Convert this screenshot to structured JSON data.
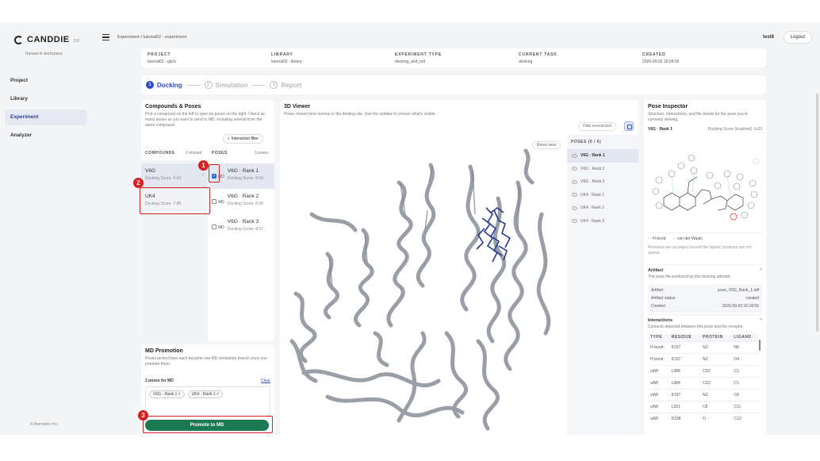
{
  "app": {
    "name": "CANDDIE",
    "version": "2.0",
    "subtitle": "Research workspace",
    "copyright": "© Atomatrix Inc."
  },
  "nav": [
    {
      "label": "Project",
      "active": false
    },
    {
      "label": "Library",
      "active": false
    },
    {
      "label": "Experiment",
      "active": true
    },
    {
      "label": "Analyzer",
      "active": false
    }
  ],
  "topbar": {
    "breadcrumb": "Experiment / tutorial02 - experiment",
    "user": "test8",
    "logout": "Logout"
  },
  "info": [
    {
      "label": "PROJECT",
      "value": "tutorial02 - glp1r"
    },
    {
      "label": "LIBRARY",
      "value": "tutorial02 - library"
    },
    {
      "label": "EXPERIMENT TYPE",
      "value": "docking_and_md"
    },
    {
      "label": "CURRENT TASK",
      "value": "docking"
    },
    {
      "label": "CREATED",
      "value": "2026-09-02 16:04:50"
    }
  ],
  "steps": [
    {
      "num": "1",
      "label": "Docking",
      "active": true
    },
    {
      "num": "2",
      "label": "Simulation",
      "active": false
    },
    {
      "num": "3",
      "label": "Report",
      "active": false
    }
  ],
  "compounds_panel": {
    "title": "Compounds & Poses",
    "desc": "Pick a compound on the left to open its poses on the right. Check as many poses as you want to send to MD, including several from the same compound.",
    "filter": "Interaction filter",
    "compounds_head": "COMPOUNDS",
    "compounds_sub": "2 docked",
    "poses_head": "POSES",
    "poses_sub": "3 poses",
    "compounds": [
      {
        "name": "V6G",
        "score": "Docking Score -9.63"
      },
      {
        "name": "UK4",
        "score": "Docking Score -7.85"
      }
    ],
    "poses": [
      {
        "tag": "MD",
        "name": "V6G · Rank 1",
        "score": "Docking Score -9.63",
        "checked": true
      },
      {
        "tag": "MD",
        "name": "V6G · Rank 2",
        "score": "Docking Score -9.00",
        "checked": false
      },
      {
        "tag": "MD",
        "name": "V6G · Rank 3",
        "score": "Docking Score -8.57",
        "checked": false
      }
    ]
  },
  "md_panel": {
    "title": "MD Promotion",
    "desc": "Poses picked here each become one MD simulation branch once you promote them.",
    "count": "2 poses for MD",
    "clear": "Clear",
    "chips": [
      "V6G · Rank 1 ×",
      "UK4 · Rank 1 ×"
    ],
    "button": "Promote to MD"
  },
  "viewer": {
    "title": "3D Viewer",
    "desc": "Poses shown here overlay in the binding site. Use the sidebar to choose what's visible.",
    "hide_btn": "Hide unselected",
    "reset": "Reset view",
    "poses_head": "POSES (0 / 6)",
    "poses": [
      "V6G · Rank 1",
      "V6G · Rank 2",
      "V6G · Rank 3",
      "UK4 · Rank 1",
      "UK4 · Rank 2",
      "UK4 · Rank 3"
    ]
  },
  "inspector": {
    "title": "Pose Inspector",
    "desc": "Structure, interactions, and file details for the pose you're currently viewing.",
    "pose": "V6G · Rank 1",
    "score": "Docking Score (kcal/mol) -9.63",
    "legend_hbond": "H-bond",
    "legend_vdw": "van der Waals",
    "legend_note": "Residues are arranged around the ligand; positions are not spatial.",
    "artifact_title": "Artifact",
    "artifact_desc": "The pose file produced by this docking attempt.",
    "artifact": [
      {
        "k": "Artifact",
        "v": "pose_V6G_Rank_1.sdf"
      },
      {
        "k": "Artifact status",
        "v": "created"
      },
      {
        "k": "Created",
        "v": "2026-09-02 16:18:56"
      }
    ],
    "inter_title": "Interactions",
    "inter_desc": "Contacts detected between this pose and the receptor.",
    "inter_head": [
      "TYPE",
      "RESIDUE",
      "PROTEIN",
      "LIGAND"
    ],
    "interactions": [
      [
        "H-bond",
        "K197",
        "NZ",
        "N9"
      ],
      [
        "H-bond",
        "K197",
        "NZ",
        "O4"
      ],
      [
        "vdW",
        "L388",
        "CD2",
        "C1"
      ],
      [
        "vdW",
        "L384",
        "CD2",
        "C1"
      ],
      [
        "vdW",
        "K197",
        "NZ",
        "C8"
      ],
      [
        "vdW",
        "L201",
        "C8",
        "C11"
      ],
      [
        "vdW",
        "D198",
        "O",
        "C12"
      ]
    ]
  },
  "annotations": [
    "1",
    "2",
    "3"
  ],
  "colors": {
    "accent": "#2d4bcc",
    "promote": "#1c7a53",
    "annotation": "#d92020",
    "protein": "#9a9ea6",
    "ligand": "#243a8f"
  }
}
